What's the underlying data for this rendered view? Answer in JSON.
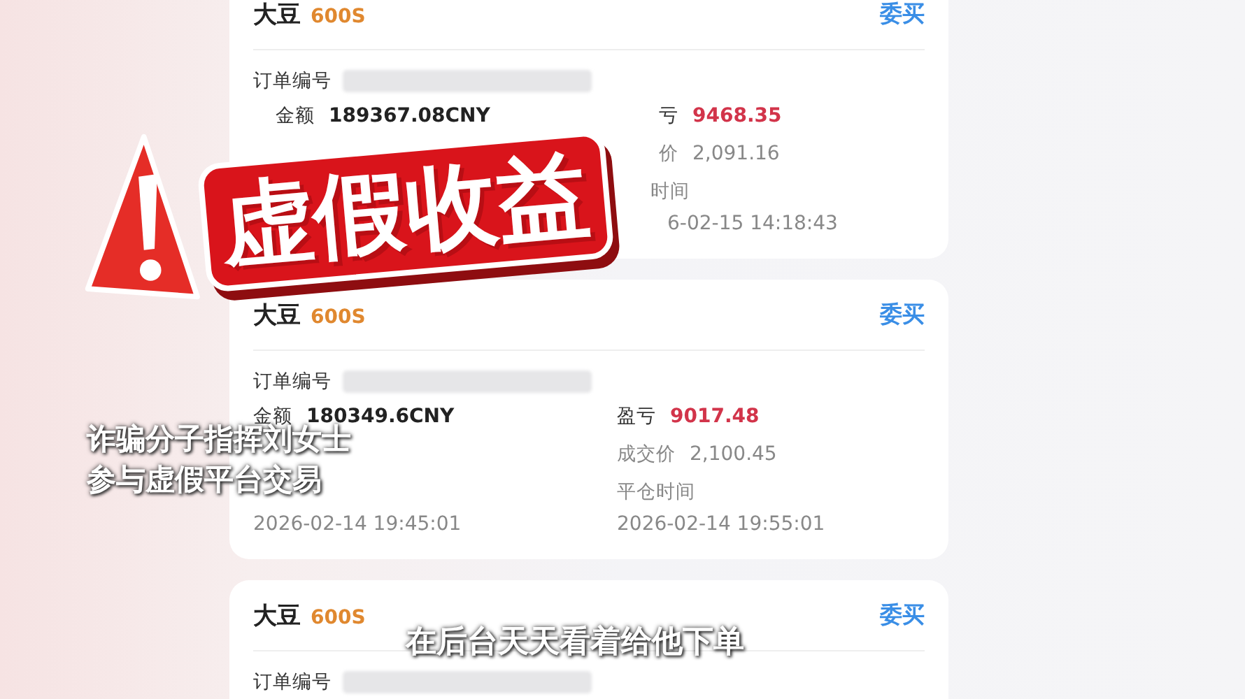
{
  "orders": [
    {
      "name": "大豆",
      "contract": "600S",
      "side": "委买",
      "order_no_label": "订单编号",
      "left": [
        {
          "kind": "amount",
          "label": "金额",
          "value": "189367.08CNY"
        }
      ],
      "right": [
        {
          "kind": "pnl",
          "label": "亏",
          "value": "9468.35"
        },
        {
          "kind": "price",
          "label": "价",
          "value": "2,091.16"
        },
        {
          "kind": "time-label",
          "label": "时间"
        },
        {
          "kind": "time",
          "value": "6-02-15 14:18:43"
        }
      ]
    },
    {
      "name": "大豆",
      "contract": "600S",
      "side": "委买",
      "order_no_label": "订单编号",
      "left": [
        {
          "kind": "amount",
          "label": "金额",
          "value": "180349.6CNY"
        },
        {
          "kind": "time",
          "value": "2026-02-14 19:45:01"
        }
      ],
      "right": [
        {
          "kind": "pnl",
          "label": "盈亏",
          "value": "9017.48"
        },
        {
          "kind": "price",
          "label": "成交价",
          "value": "2,100.45"
        },
        {
          "kind": "time-label",
          "label": "平仓时间"
        },
        {
          "kind": "time",
          "value": "2026-02-14 19:55:01"
        }
      ]
    },
    {
      "name": "大豆",
      "contract": "600S",
      "side": "委买",
      "order_no_label": "订单编号"
    }
  ],
  "stamp": {
    "text": "虚假收益"
  },
  "captions": [
    {
      "kind": "side",
      "lines": [
        "诈骗分子指挥刘女士",
        "参与虚假平台交易"
      ]
    },
    {
      "kind": "bottom",
      "lines": [
        "在后台天天看着给他下单"
      ]
    }
  ]
}
